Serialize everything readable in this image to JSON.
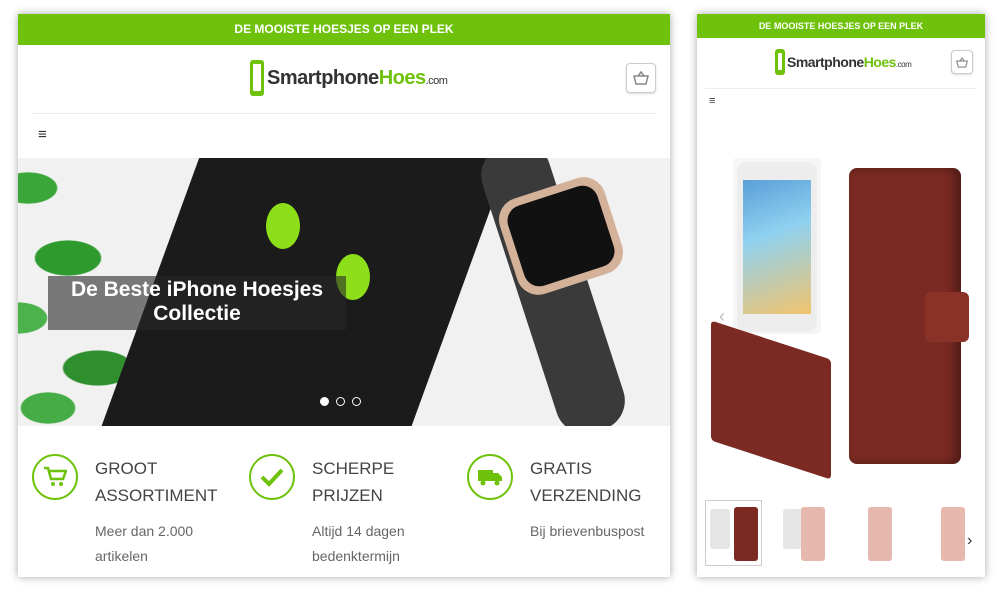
{
  "left": {
    "topbar": "DE MOOISTE HOESJES OP EEN PLEK",
    "logo": {
      "part1": "Smartphone",
      "part2": "Hoes",
      "part3": ".com"
    },
    "menu_icon": "hamburger-icon",
    "hero": {
      "caption_line1": "De Beste iPhone Hoesjes",
      "caption_line2": "Collectie",
      "slides": 3,
      "active_slide": 1
    },
    "features": [
      {
        "icon": "cart-icon",
        "title_line1": "GROOT",
        "title_line2": "ASSORTIMENT",
        "sub_line1": "Meer dan 2.000",
        "sub_line2": "artikelen"
      },
      {
        "icon": "check-icon",
        "title_line1": "SCHERPE",
        "title_line2": "PRIJZEN",
        "sub_line1": "Altijd 14 dagen",
        "sub_line2": "bedenktermijn"
      },
      {
        "icon": "truck-icon",
        "title_line1": "GRATIS",
        "title_line2": "VERZENDING",
        "sub_line1": "Bij brievenbuspost",
        "sub_line2": ""
      }
    ]
  },
  "right": {
    "topbar": "DE MOOISTE HOESJES OP EEN PLEK",
    "logo": {
      "part1": "Smartphone",
      "part2": "Hoes",
      "part3": ".com"
    },
    "prev_arrow": "‹",
    "next_arrow": "›",
    "thumbnails": 4
  },
  "colors": {
    "brand_green": "#6fc20b",
    "wallet_brown": "#7a2a22",
    "rose_gold": "#e7b8ad"
  }
}
